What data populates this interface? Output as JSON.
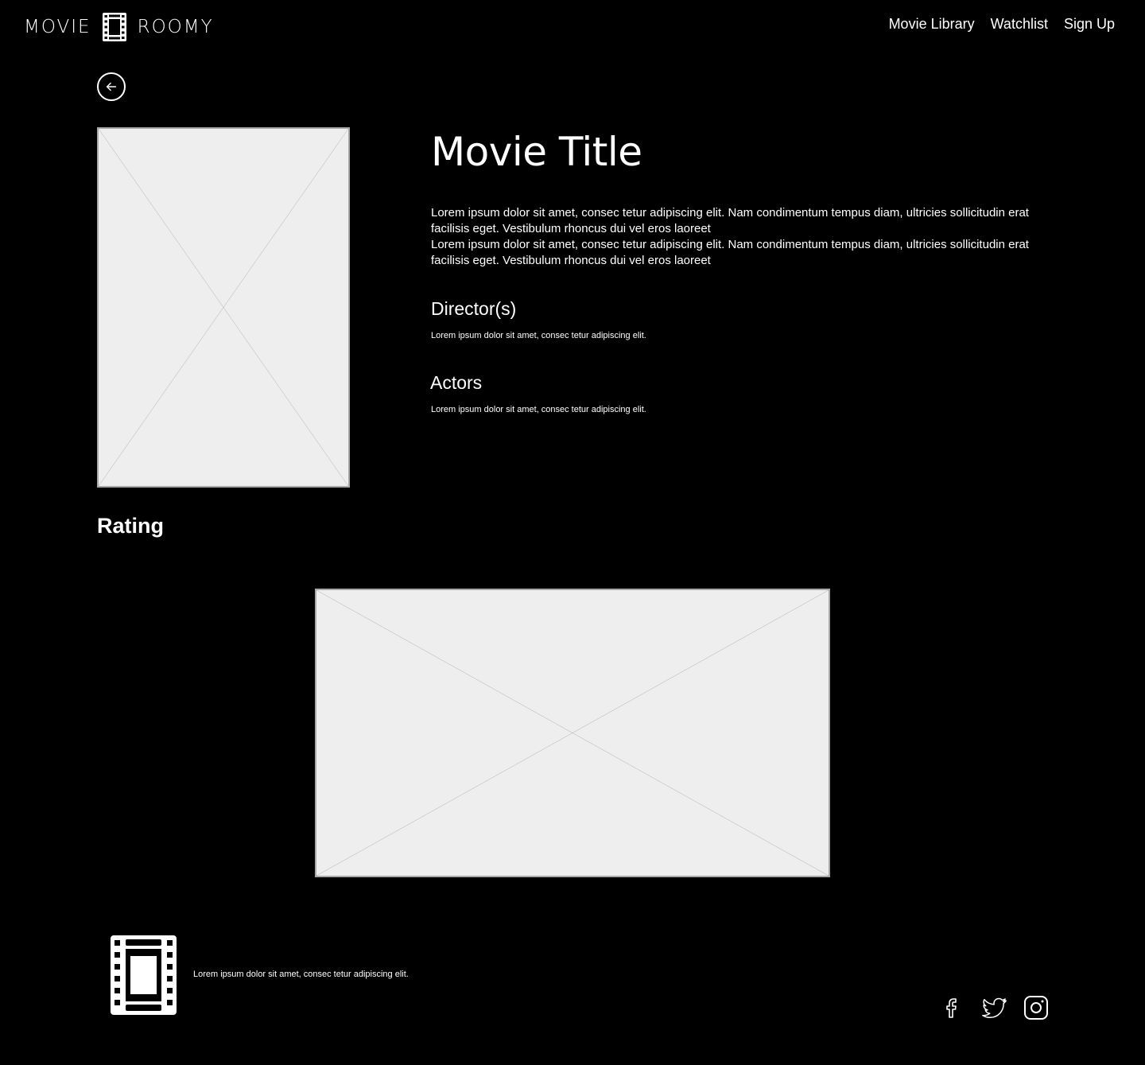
{
  "header": {
    "logo_left": "MOVIE",
    "logo_right": "ROOMY",
    "nav": [
      {
        "label": "Movie Library"
      },
      {
        "label": "Watchlist"
      },
      {
        "label": "Sign Up"
      }
    ]
  },
  "movie": {
    "title": "Movie Title",
    "description_1": "Lorem ipsum dolor sit amet, consec tetur adipiscing elit. Nam condimentum tempus diam, ultricies sollicitudin erat facilisis eget. Vestibulum rhoncus dui vel eros laoreet",
    "description_2": "Lorem ipsum dolor sit amet, consec tetur adipiscing elit. Nam condimentum tempus diam, ultricies sollicitudin erat facilisis eget. Vestibulum rhoncus dui vel eros laoreet",
    "directors_heading": "Director(s)",
    "directors_text": "Lorem ipsum dolor sit amet, consec tetur adipiscing elit.",
    "actors_heading": "Actors",
    "actors_text": "Lorem ipsum dolor sit amet, consec tetur adipiscing elit."
  },
  "rating": {
    "heading": "Rating"
  },
  "footer": {
    "text": "Lorem ipsum dolor sit amet, consec tetur adipiscing elit.",
    "social_icons": [
      "facebook-icon",
      "twitter-icon",
      "instagram-icon"
    ]
  },
  "colors": {
    "background": "#000000",
    "text": "#ffffff",
    "placeholder_fill": "#eeeeee",
    "placeholder_stroke": "#a8a8a8"
  }
}
